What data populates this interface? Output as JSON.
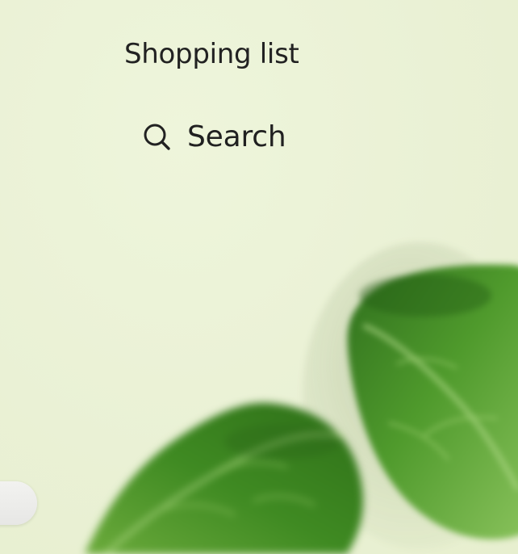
{
  "header": {
    "title": "Shopping list"
  },
  "search": {
    "label": "Search",
    "icon": "search-icon"
  },
  "colors": {
    "background": "#ecf3d8",
    "text": "#222222",
    "leaf_dark": "#2f6f1d",
    "leaf_mid": "#4f9a2c",
    "leaf_light": "#8cc45e"
  }
}
